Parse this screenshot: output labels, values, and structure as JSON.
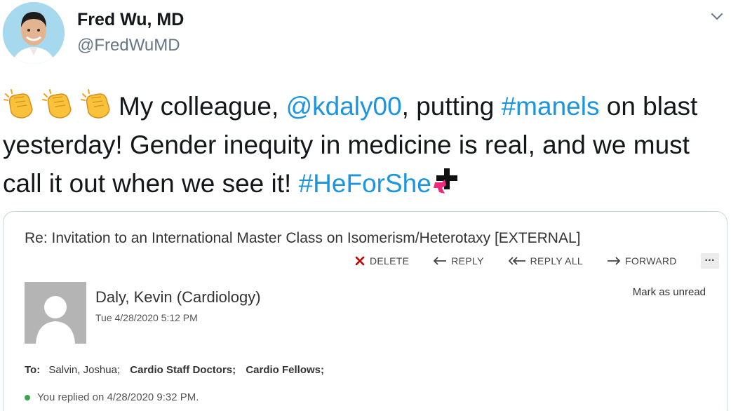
{
  "tweet": {
    "author_name": "Fred Wu, MD",
    "author_handle": "@FredWuMD",
    "text": {
      "part1": "My colleague, ",
      "mention": "@kdaly00",
      "part2": ", putting ",
      "hashtag1": "#manels",
      "part3": " on blast yesterday! Gender inequity in medicine is real, and we must call it out when we see it! ",
      "hashtag2": "#HeForShe"
    },
    "link_color": "#1b95e0"
  },
  "email": {
    "subject": "Re: Invitation to an International Master Class on Isomerism/Heterotaxy [EXTERNAL]",
    "toolbar": {
      "delete": "DELETE",
      "reply": "REPLY",
      "reply_all": "REPLY ALL",
      "forward": "FORWARD",
      "more": "..."
    },
    "sender": "Daly, Kevin (Cardiology)",
    "date": "Tue 4/28/2020 5:12 PM",
    "mark_unread": "Mark as unread",
    "to_label": "To:",
    "recipients": [
      "Salvin, Joshua;",
      "Cardio Staff Doctors;",
      "Cardio Fellows;"
    ],
    "replied": "You replied on 4/28/2020 9:32 PM."
  },
  "icons": {
    "clap": "clapping-hands-icon",
    "caret": "chevron-down-icon",
    "delete": "x-icon",
    "reply": "arrow-left-icon",
    "reply_all": "double-arrow-left-icon",
    "forward": "arrow-right-icon",
    "heforshe": "heforshe-logo-icon"
  }
}
